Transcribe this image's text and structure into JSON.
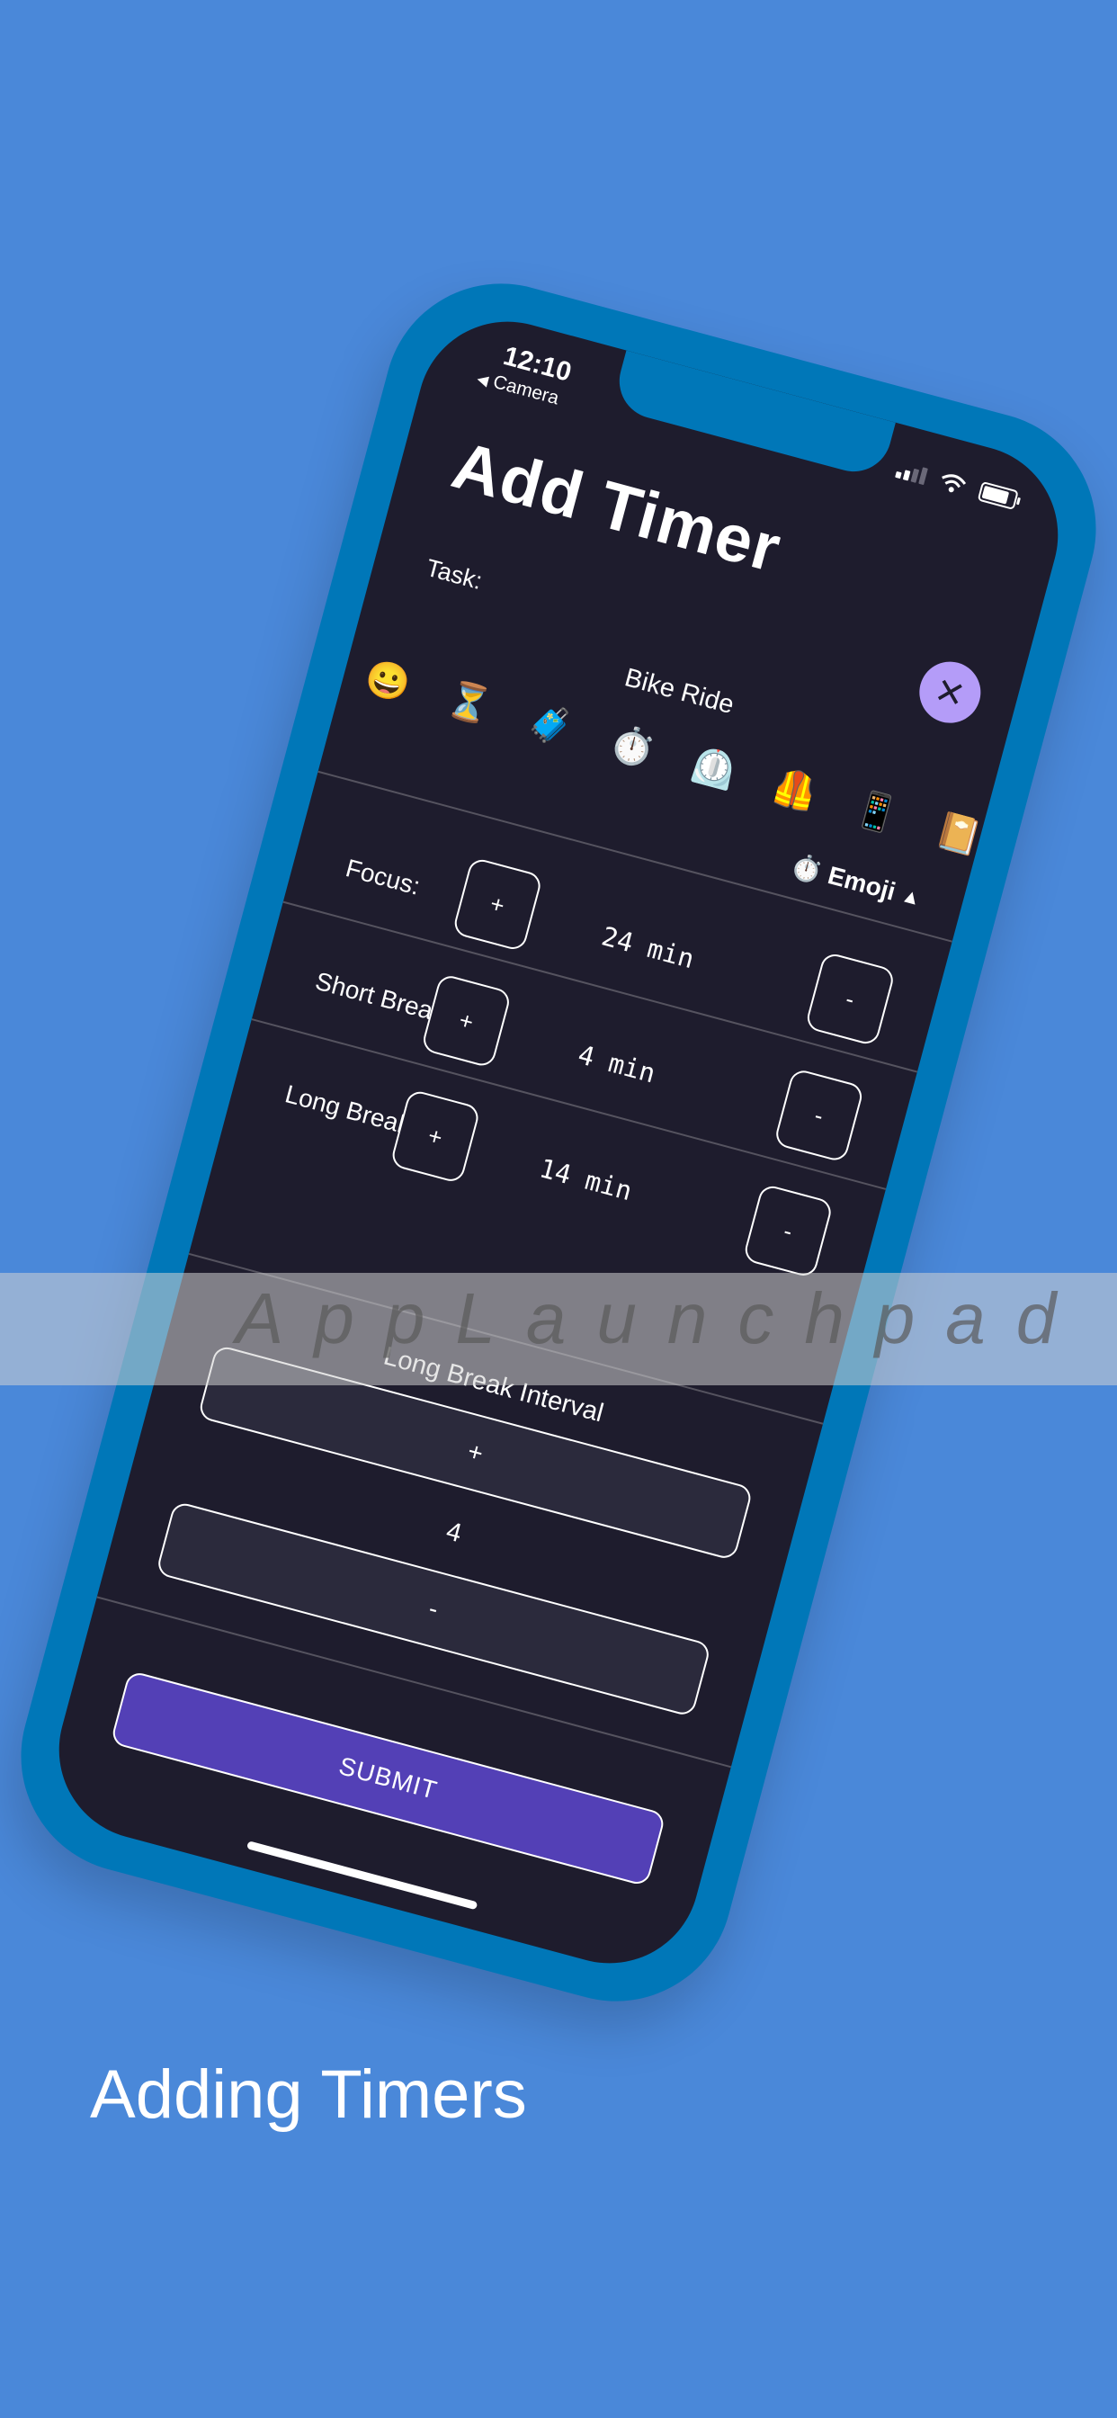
{
  "status_bar": {
    "time": "12:10",
    "back_label": "Camera"
  },
  "page_title": "Add Timer",
  "close_button_glyph": "×",
  "task": {
    "label": "Task:",
    "value": "Bike Ride"
  },
  "emoji_picker": {
    "items": [
      "😀",
      "⏳",
      "🧳",
      "⏱️",
      "⏲️",
      "🦺",
      "📱",
      "📔",
      "🕯️"
    ],
    "toggle_icon": "⏱️",
    "toggle_label": "Emoji",
    "toggle_arrow": "▲"
  },
  "rows": {
    "focus": {
      "label": "Focus:",
      "value": "24 min",
      "plus": "+",
      "minus": "-"
    },
    "short_break": {
      "label": "Short Break:",
      "value": "4 min",
      "plus": "+",
      "minus": "-"
    },
    "long_break": {
      "label": "Long Break:",
      "value": "14 min",
      "plus": "+",
      "minus": "-"
    }
  },
  "long_break_interval": {
    "label": "Long Break Interval",
    "plus": "+",
    "value": "4",
    "minus": "-"
  },
  "submit_label": "SUBMIT",
  "watermark": "AppLaunchpad",
  "caption": "Adding Timers",
  "colors": {
    "background": "#4a88d9",
    "phone_frame": "#0077b8",
    "screen": "#1e1c2d",
    "close_button": "#b49cf8",
    "submit": "#5340b6"
  }
}
